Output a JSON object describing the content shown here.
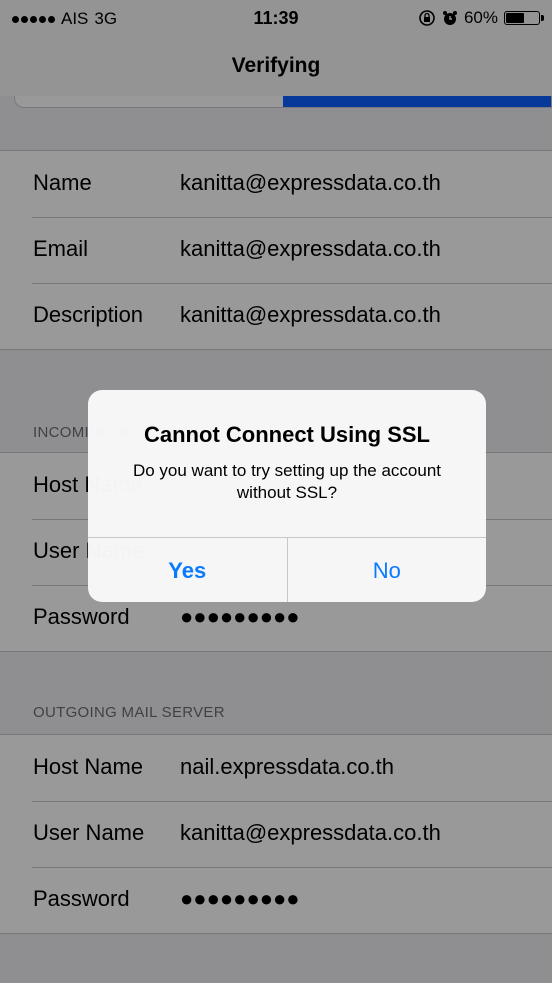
{
  "status_bar": {
    "carrier": "AIS",
    "network": "3G",
    "time": "11:39",
    "battery": "60%",
    "battery_level": 0.6
  },
  "nav": {
    "title": "Verifying",
    "progress": 0.5
  },
  "account": {
    "rows": [
      {
        "label": "Name",
        "value": "kanitta@expressdata.co.th"
      },
      {
        "label": "Email",
        "value": "kanitta@expressdata.co.th"
      },
      {
        "label": "Description",
        "value": "kanitta@expressdata.co.th"
      }
    ]
  },
  "incoming": {
    "header": "INCOMING MAIL SERVER",
    "rows": [
      {
        "label": "Host Name",
        "value": ""
      },
      {
        "label": "User Name",
        "value": ""
      },
      {
        "label": "Password",
        "value": "●●●●●●●●●"
      }
    ]
  },
  "outgoing": {
    "header": "OUTGOING MAIL SERVER",
    "rows": [
      {
        "label": "Host Name",
        "value": "nail.expressdata.co.th"
      },
      {
        "label": "User Name",
        "value": "kanitta@expressdata.co.th"
      },
      {
        "label": "Password",
        "value": "●●●●●●●●●"
      }
    ]
  },
  "alert": {
    "title": "Cannot Connect Using SSL",
    "message": "Do you want to try setting up the account without SSL?",
    "yes_label": "Yes",
    "no_label": "No"
  },
  "colors": {
    "accent": "#0a7aff",
    "progress": "#0a60ff",
    "background": "#efeff4"
  }
}
